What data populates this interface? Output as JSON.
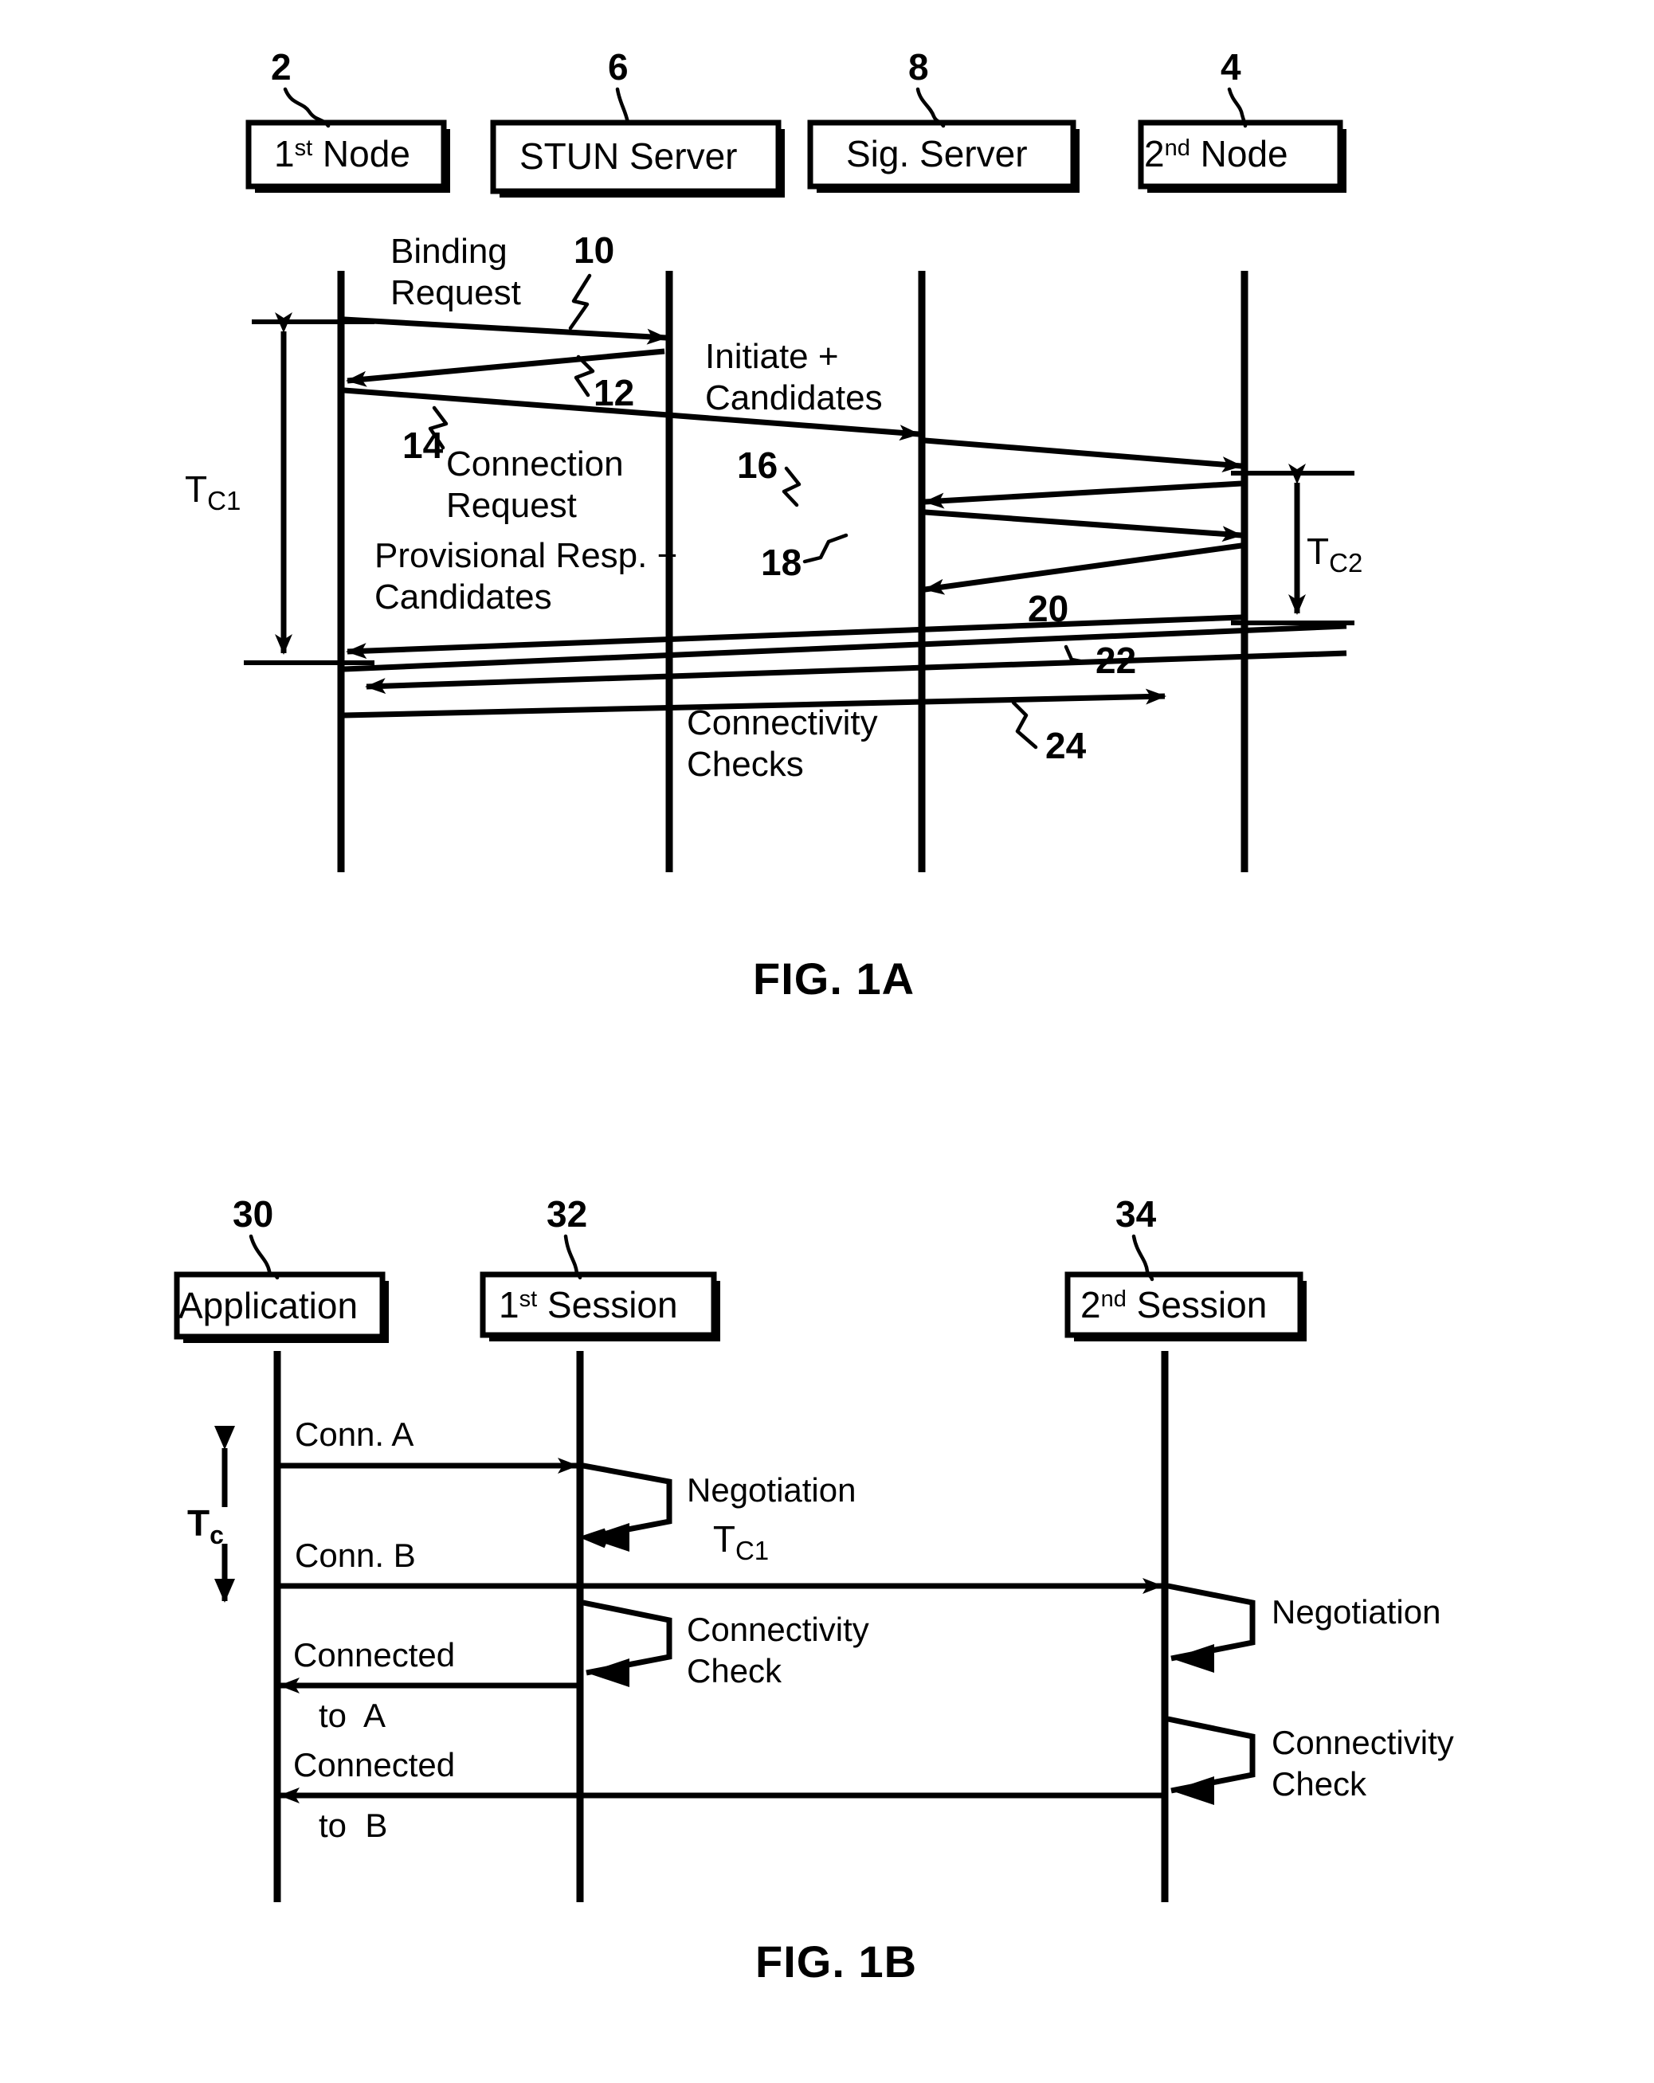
{
  "document": {
    "type": "patent-drawing-sheet",
    "figures": [
      "FIG. 1A",
      "FIG. 1B"
    ]
  },
  "fig1a": {
    "caption": "FIG. 1A",
    "participants": [
      {
        "ref": "2",
        "label_main": "1",
        "label_sup": "st",
        "label_rest": " Node",
        "label_plain": "1st Node"
      },
      {
        "ref": "6",
        "label_main": "STUN Server",
        "label_sup": "",
        "label_rest": "",
        "label_plain": "STUN Server"
      },
      {
        "ref": "8",
        "label_main": "Sig. Server",
        "label_sup": "",
        "label_rest": "",
        "label_plain": "Sig. Server"
      },
      {
        "ref": "4",
        "label_main": "2",
        "label_sup": "nd",
        "label_rest": " Node",
        "label_plain": "2nd Node"
      }
    ],
    "messages": [
      {
        "ref": "10",
        "label_line1": "Binding",
        "label_line2": "Request",
        "from": "1st Node",
        "to": "STUN Server"
      },
      {
        "ref": "12",
        "label_line1": "",
        "label_line2": "",
        "from": "STUN Server",
        "to": "1st Node"
      },
      {
        "ref": "14",
        "label_line1": "Connection",
        "label_line2": "Request",
        "from": "1st Node",
        "to": "Sig. Server"
      },
      {
        "ref": "16",
        "label_line1": "Initiate +",
        "label_line2": "Candidates",
        "from": "Sig. Server",
        "to": "2nd Node"
      },
      {
        "ref": "18",
        "label_line1": "Provisional Resp. +",
        "label_line2": "Candidates",
        "from": "2nd Node",
        "to": "Sig. Server"
      },
      {
        "ref": "20",
        "label_line1": "",
        "label_line2": "",
        "from": "Sig. Server",
        "to": "2nd Node"
      },
      {
        "ref": "22",
        "label_line1": "",
        "label_line2": "",
        "from": "2nd Node",
        "to": "1st Node"
      },
      {
        "ref": "24",
        "label_line1": "Connectivity",
        "label_line2": "Checks",
        "from": "1st Node",
        "to": "2nd Node"
      }
    ],
    "message_labels": {
      "binding_request_1": "Binding",
      "binding_request_2": "Request",
      "initiate_1": "Initiate +",
      "initiate_2": "Candidates",
      "connection_1": "Connection",
      "connection_2": "Request",
      "provisional_1": "Provisional Resp. +",
      "provisional_2": "Candidates",
      "connectivity_1": "Connectivity",
      "connectivity_2": "Checks"
    },
    "ref_numerals": {
      "n2": "2",
      "n4": "4",
      "n6": "6",
      "n8": "8",
      "n10": "10",
      "n12": "12",
      "n14": "14",
      "n16": "16",
      "n18": "18",
      "n20": "20",
      "n22": "22",
      "n24": "24"
    },
    "durations": [
      {
        "name": "T",
        "sub": "C1",
        "plain": "TC1",
        "spans": "1st Node lifeline, Binding Request to Connectivity Checks"
      },
      {
        "name": "T",
        "sub": "C2",
        "plain": "TC2",
        "spans": "2nd Node lifeline, Initiate+Candidates to message 20"
      }
    ]
  },
  "fig1b": {
    "caption": "FIG. 1B",
    "participants": [
      {
        "ref": "30",
        "label_main": "Application",
        "label_sup": "",
        "label_rest": "",
        "label_plain": "Application"
      },
      {
        "ref": "32",
        "label_main": "1",
        "label_sup": "st",
        "label_rest": " Session",
        "label_plain": "1st Session"
      },
      {
        "ref": "34",
        "label_main": "2",
        "label_sup": "nd",
        "label_rest": " Session",
        "label_plain": "2nd Session"
      }
    ],
    "messages": [
      {
        "label_line1": "Conn. A",
        "label_line2": "",
        "from": "Application",
        "to": "1st Session"
      },
      {
        "label_line1": "Conn. B",
        "label_line2": "",
        "from": "Application",
        "to": "2nd Session"
      },
      {
        "label_line1": "Connected",
        "label_line2": "to  A",
        "from": "1st Session",
        "to": "Application"
      },
      {
        "label_line1": "Connected",
        "label_line2": "to  B",
        "from": "2nd Session",
        "to": "Application"
      }
    ],
    "self_loops": [
      {
        "label_line1": "Negotiation",
        "label_line2": "",
        "sub": "C1",
        "on": "1st Session"
      },
      {
        "label_line1": "Connectivity",
        "label_line2": "Check",
        "sub": "",
        "on": "1st Session"
      },
      {
        "label_line1": "Negotiation",
        "label_line2": "",
        "sub": "",
        "on": "2nd Session"
      },
      {
        "label_line1": "Connectivity",
        "label_line2": "Check",
        "sub": "",
        "on": "2nd Session"
      }
    ],
    "ref_numerals": {
      "n30": "30",
      "n32": "32",
      "n34": "34"
    },
    "message_labels": {
      "conn_a": "Conn. A",
      "conn_b": "Conn. B",
      "connected_1": "Connected",
      "connected_to_a": "to  A",
      "connected_2": "Connected",
      "connected_to_b": "to  B",
      "negotiation_1": "Negotiation",
      "negotiation_2": "Negotiation",
      "connectivity_1": "Connectivity",
      "connectivity_check_1": "Check",
      "connectivity_2": "Connectivity",
      "connectivity_check_2": "Check"
    },
    "durations": [
      {
        "name": "T",
        "sub": "c",
        "plain": "Tc",
        "spans": "Application lifeline, Conn. A to Connected to A"
      },
      {
        "name": "T",
        "sub": "C1",
        "plain": "TC1",
        "spans": "1st Session negotiation"
      }
    ]
  },
  "colors": {
    "ink": "#000000",
    "paper": "#ffffff"
  }
}
